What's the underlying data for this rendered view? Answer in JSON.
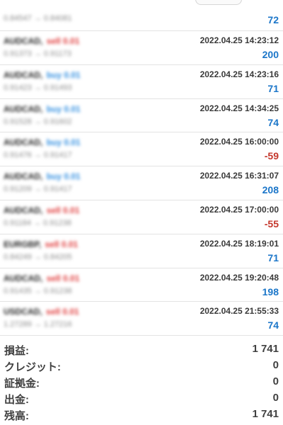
{
  "trades": [
    {
      "symbol": "",
      "direction": "",
      "direction_type": "buy",
      "prices": "0.84547 → 0.84081",
      "time": "",
      "profit": "72",
      "profit_sign": "pos"
    },
    {
      "symbol": "AUDCAD,",
      "direction": "sell 0.01",
      "direction_type": "sell",
      "prices": "0.91373 → 0.91173",
      "time": "2022.04.25 14:23:12",
      "profit": "200",
      "profit_sign": "pos"
    },
    {
      "symbol": "AUDCAD,",
      "direction": "buy 0.01",
      "direction_type": "buy",
      "prices": "0.91423 → 0.91493",
      "time": "2022.04.25 14:23:16",
      "profit": "71",
      "profit_sign": "pos"
    },
    {
      "symbol": "AUDCAD,",
      "direction": "buy 0.01",
      "direction_type": "buy",
      "prices": "0.91528 → 0.91602",
      "time": "2022.04.25 14:34:25",
      "profit": "74",
      "profit_sign": "pos"
    },
    {
      "symbol": "AUDCAD,",
      "direction": "buy 0.01",
      "direction_type": "buy",
      "prices": "0.91476 → 0.91417",
      "time": "2022.04.25 16:00:00",
      "profit": "-59",
      "profit_sign": "neg"
    },
    {
      "symbol": "AUDCAD,",
      "direction": "buy 0.01",
      "direction_type": "buy",
      "prices": "0.91209 → 0.91417",
      "time": "2022.04.25 16:31:07",
      "profit": "208",
      "profit_sign": "pos"
    },
    {
      "symbol": "AUDCAD,",
      "direction": "sell 0.01",
      "direction_type": "sell",
      "prices": "0.91184 → 0.91238",
      "time": "2022.04.25 17:00:00",
      "profit": "-55",
      "profit_sign": "neg"
    },
    {
      "symbol": "EURGBP,",
      "direction": "sell 0.01",
      "direction_type": "sell",
      "prices": "0.84249 → 0.84205",
      "time": "2022.04.25 18:19:01",
      "profit": "71",
      "profit_sign": "pos"
    },
    {
      "symbol": "AUDCAD,",
      "direction": "sell 0.01",
      "direction_type": "sell",
      "prices": "0.91435 → 0.91238",
      "time": "2022.04.25 19:20:48",
      "profit": "198",
      "profit_sign": "pos"
    },
    {
      "symbol": "USDCAD,",
      "direction": "sell 0.01",
      "direction_type": "sell",
      "prices": "1.27289 → 1.27216",
      "time": "2022.04.25 21:55:33",
      "profit": "74",
      "profit_sign": "pos"
    }
  ],
  "summary": {
    "profit_label": "損益:",
    "profit_value": "1 741",
    "credit_label": "クレジット:",
    "credit_value": "0",
    "margin_label": "証拠金:",
    "margin_value": "0",
    "withdrawal_label": "出金:",
    "withdrawal_value": "0",
    "balance_label": "残高:",
    "balance_value": "1 741"
  },
  "colors": {
    "positive": "#1b76c9",
    "negative": "#c4372c",
    "buy": "#2e8de0",
    "sell": "#e03a3a"
  }
}
